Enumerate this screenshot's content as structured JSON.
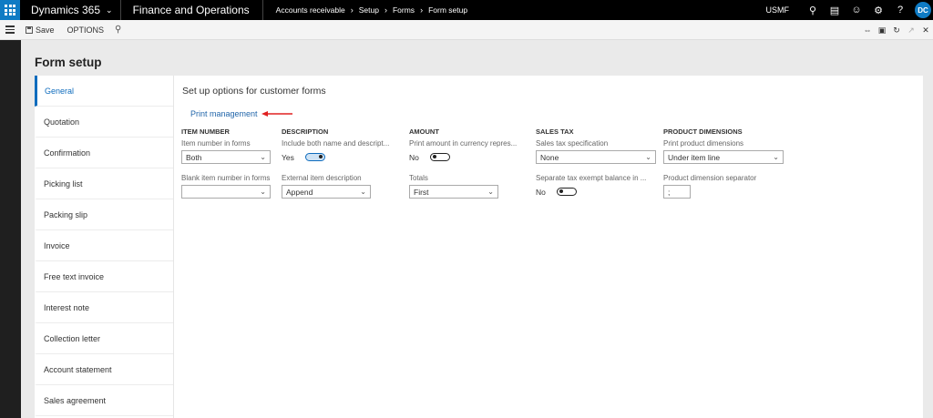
{
  "topbar": {
    "app_name": "Dynamics 365",
    "module_name": "Finance and Operations",
    "breadcrumbs": [
      "Accounts receivable",
      "Setup",
      "Forms",
      "Form setup"
    ],
    "company": "USMF",
    "user_initials": "DC",
    "accent": "#0f7bc4"
  },
  "actionbar": {
    "save_label": "Save",
    "options_label": "OPTIONS"
  },
  "page": {
    "title": "Form setup"
  },
  "tabs": [
    {
      "label": "General",
      "active": true
    },
    {
      "label": "Quotation"
    },
    {
      "label": "Confirmation"
    },
    {
      "label": "Picking list"
    },
    {
      "label": "Packing slip"
    },
    {
      "label": "Invoice"
    },
    {
      "label": "Free text invoice"
    },
    {
      "label": "Interest note"
    },
    {
      "label": "Collection letter"
    },
    {
      "label": "Account statement"
    },
    {
      "label": "Sales agreement"
    }
  ],
  "general": {
    "section_title": "Set up options for customer forms",
    "print_management_link": "Print management",
    "item_number": {
      "header": "ITEM NUMBER",
      "item_number_in_forms_label": "Item number in forms",
      "item_number_in_forms_value": "Both",
      "blank_item_number_label": "Blank item number in forms",
      "blank_item_number_value": ""
    },
    "description": {
      "header": "DESCRIPTION",
      "include_both_label": "Include both name and descript...",
      "include_both_state": "Yes",
      "external_desc_label": "External item description",
      "external_desc_value": "Append"
    },
    "amount": {
      "header": "AMOUNT",
      "print_currency_label": "Print amount in currency repres...",
      "print_currency_state": "No",
      "totals_label": "Totals",
      "totals_value": "First"
    },
    "sales_tax": {
      "header": "SALES TAX",
      "spec_label": "Sales tax specification",
      "spec_value": "None",
      "separate_label": "Separate tax exempt balance in ...",
      "separate_state": "No"
    },
    "product_dimensions": {
      "header": "PRODUCT DIMENSIONS",
      "print_dims_label": "Print product dimensions",
      "print_dims_value": "Under item line",
      "separator_label": "Product dimension separator",
      "separator_value": ";"
    }
  }
}
